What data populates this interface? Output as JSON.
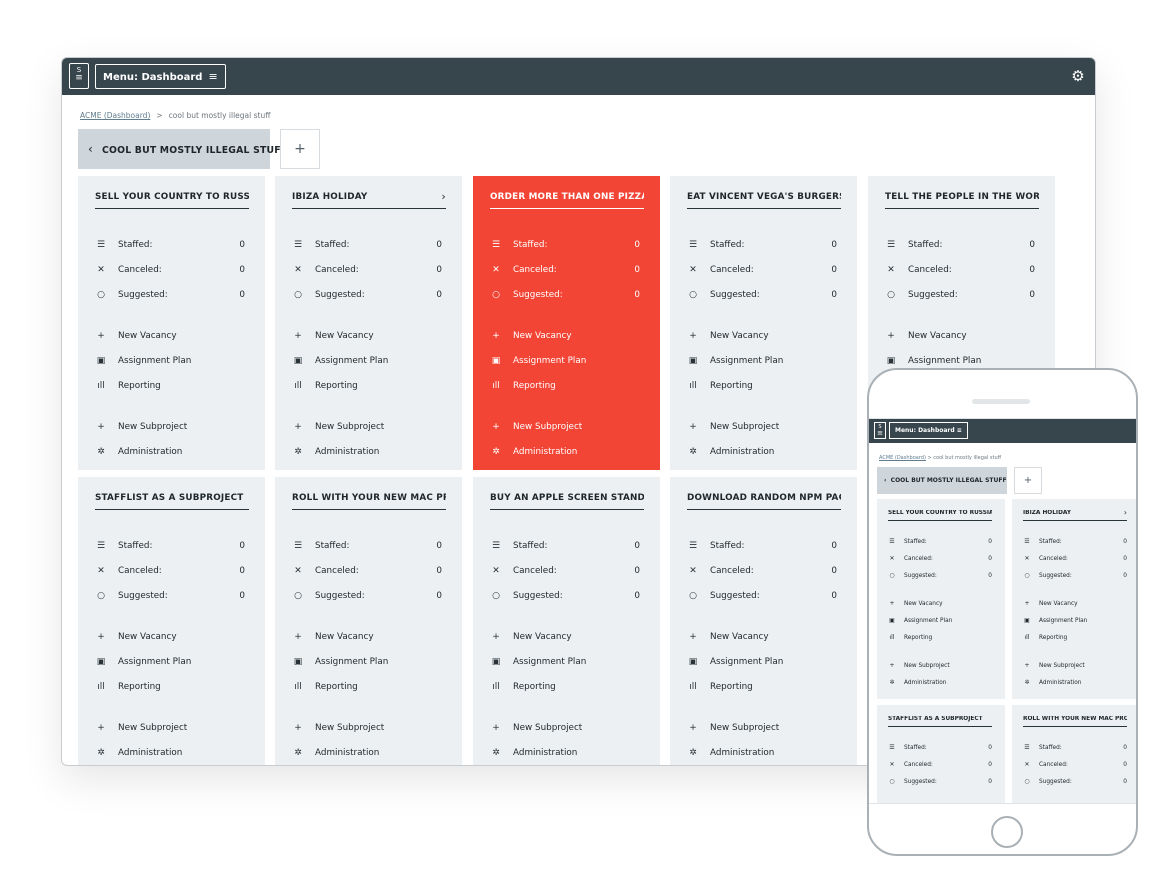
{
  "app": {
    "logo": {
      "line1": "S",
      "line2": "≡"
    },
    "menu_label": "Menu: Dashboard",
    "menu_icon": "≡",
    "settings_icon": "gear-icon"
  },
  "breadcrumb": {
    "root": "ACME (Dashboard)",
    "separator": ">",
    "current": "cool but mostly illegal stuff"
  },
  "project": {
    "title": "COOL BUT MOSTLY ILLEGAL STUFF",
    "back_icon": "‹",
    "add_icon": "+"
  },
  "labels": {
    "staffed": "Staffed:",
    "canceled": "Canceled:",
    "suggested": "Suggested:",
    "new_vacancy": "New Vacancy",
    "assignment_plan": "Assignment Plan",
    "reporting": "Reporting",
    "new_subproject": "New Subproject",
    "administration": "Administration"
  },
  "accent_color": "#f24535",
  "cards": [
    {
      "title": "SELL YOUR COUNTRY TO RUSSIA",
      "staffed": "0",
      "canceled": "0",
      "suggested": "0"
    },
    {
      "title": "IBIZA HOLIDAY",
      "arrow": "›",
      "staffed": "0",
      "canceled": "0",
      "suggested": "0"
    },
    {
      "title": "ORDER MORE THAN ONE PIZZA",
      "active": true,
      "staffed": "0",
      "canceled": "0",
      "suggested": "0"
    },
    {
      "title": "EAT VINCENT VEGA'S BURGERS IN...",
      "staffed": "0",
      "canceled": "0",
      "suggested": "0"
    },
    {
      "title": "TELL THE PEOPLE IN THE WORLD ...",
      "staffed": "0",
      "canceled": "0",
      "suggested": "0"
    },
    {
      "title": "STAFFLIST AS A SUBPROJECT",
      "staffed": "0",
      "canceled": "0",
      "suggested": "0"
    },
    {
      "title": "ROLL WITH YOUR NEW MAC PRO T...",
      "staffed": "0",
      "canceled": "0",
      "suggested": "0"
    },
    {
      "title": "BUY AN APPLE SCREEN STAND FO...",
      "staffed": "0",
      "canceled": "0",
      "suggested": "0"
    },
    {
      "title": "DOWNLOAD RANDOM NPM PACKA...",
      "staffed": "0",
      "canceled": "0",
      "suggested": "0"
    }
  ],
  "mobile": {
    "menu_label": "Menu: Dashboard",
    "menu_icon": "≡",
    "breadcrumb_root": "ACME (Dashboard)",
    "breadcrumb_current": "cool but mostly illegal stuff",
    "project_title": "COOL BUT MOSTLY ILLEGAL STUFF",
    "cards": [
      {
        "title": "SELL YOUR COUNTRY TO RUSSIA",
        "staffed": "0",
        "canceled": "0",
        "suggested": "0"
      },
      {
        "title": "IBIZA HOLIDAY",
        "arrow": "›",
        "staffed": "0",
        "canceled": "0",
        "suggested": "0"
      },
      {
        "title": "STAFFLIST AS A SUBPROJECT",
        "staffed": "0",
        "canceled": "0",
        "suggested": "0"
      },
      {
        "title": "ROLL WITH YOUR NEW MAC PRO T...",
        "staffed": "0",
        "canceled": "0",
        "suggested": "0"
      }
    ]
  }
}
